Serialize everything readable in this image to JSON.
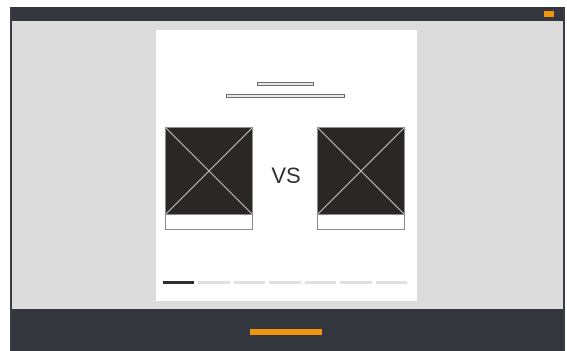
{
  "colors": {
    "chrome": "#33363d",
    "accent": "#f1950f",
    "canvas": "#dcdcdc",
    "card": "#ffffff",
    "image_placeholder": "#2a2726"
  },
  "window": {
    "top_bar_icon": "window-accent-icon",
    "bottom_bar_button_icon": "primary-action-bar"
  },
  "comparison": {
    "vs_label": "VS",
    "left_image_icon": "image-placeholder-icon",
    "right_image_icon": "image-placeholder-icon"
  },
  "pager": {
    "total_steps": 7,
    "current_step": 1
  }
}
